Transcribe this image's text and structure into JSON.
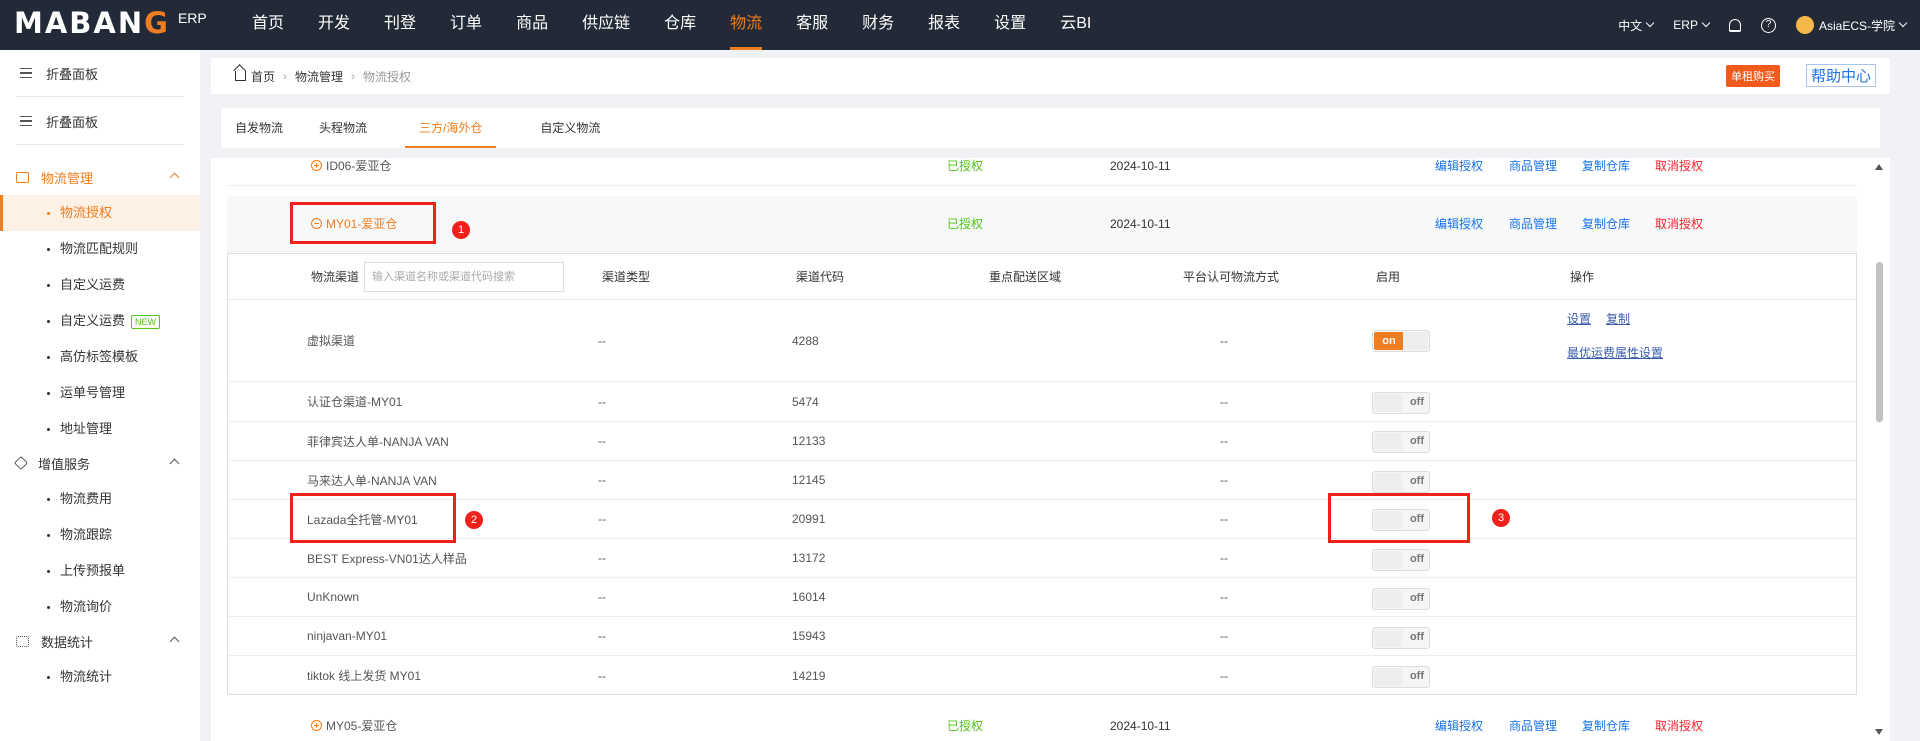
{
  "topbar": {
    "logo_main": "MABANG",
    "logo_erp": "ERP",
    "nav": [
      "首页",
      "开发",
      "刊登",
      "订单",
      "商品",
      "供应链",
      "仓库",
      "物流",
      "客服",
      "财务",
      "报表",
      "设置",
      "云BI"
    ],
    "active_nav": "物流",
    "lang": "中文",
    "erp": "ERP",
    "user": "AsiaECS-学院"
  },
  "sidebar": {
    "collapse1": "折叠面板",
    "collapse2": "折叠面板",
    "groups": [
      {
        "label": "物流管理",
        "items": [
          "物流授权",
          "物流匹配规则",
          "自定义运费",
          "自定义运费",
          "高仿标签模板",
          "运单号管理",
          "地址管理"
        ]
      },
      {
        "label": "增值服务",
        "items": [
          "物流费用",
          "物流跟踪",
          "上传预报单",
          "物流询价"
        ]
      },
      {
        "label": "数据统计",
        "items": [
          "物流统计"
        ]
      }
    ],
    "new_badge": "NEW",
    "active_item": "物流授权"
  },
  "breadcrumb": {
    "home": "首页",
    "level1": "物流管理",
    "current": "物流授权"
  },
  "buttons": {
    "buy": "单租购买",
    "help": "帮助中心"
  },
  "tabs": [
    "自发物流",
    "头程物流",
    "三方/海外仓",
    "自定义物流"
  ],
  "active_tab": "三方/海外仓",
  "warehouses": [
    {
      "name": "ID06-爱亚仓",
      "status": "已授权",
      "date": "2024-10-11"
    },
    {
      "name": "MY01-爱亚仓",
      "status": "已授权",
      "date": "2024-10-11"
    },
    {
      "name": "MY05-爱亚仓",
      "status": "已授权",
      "date": "2024-10-11"
    }
  ],
  "actions": {
    "edit": "编辑授权",
    "goods": "商品管理",
    "copy": "复制仓库",
    "cancel": "取消授权"
  },
  "subtable": {
    "headers": {
      "channel": "物流渠道",
      "type": "渠道类型",
      "code": "渠道代码",
      "region": "重点配送区域",
      "platform": "平台认可物流方式",
      "enable": "启用",
      "ops": "操作"
    },
    "search_placeholder": "输入渠道名称或渠道代码搜索",
    "rows": [
      {
        "name": "虚拟渠道",
        "type": "--",
        "code": "4288",
        "platform": "--",
        "enabled": "on"
      },
      {
        "name": "认证仓渠道-MY01",
        "type": "--",
        "code": "5474",
        "platform": "--",
        "enabled": "off"
      },
      {
        "name": "菲律宾达人单-NANJA VAN",
        "type": "--",
        "code": "12133",
        "platform": "--",
        "enabled": "off"
      },
      {
        "name": "马来达人单-NANJA VAN",
        "type": "--",
        "code": "12145",
        "platform": "--",
        "enabled": "off"
      },
      {
        "name": "Lazada全托管-MY01",
        "type": "--",
        "code": "20991",
        "platform": "--",
        "enabled": "off"
      },
      {
        "name": "BEST Express-VN01达人样品",
        "type": "--",
        "code": "13172",
        "platform": "--",
        "enabled": "off"
      },
      {
        "name": "UnKnown",
        "type": "--",
        "code": "16014",
        "platform": "--",
        "enabled": "off"
      },
      {
        "name": "ninjavan-MY01",
        "type": "--",
        "code": "15943",
        "platform": "--",
        "enabled": "off"
      },
      {
        "name": "tiktok 线上发货 MY01",
        "type": "--",
        "code": "14219",
        "platform": "--",
        "enabled": "off"
      }
    ],
    "op_set": "设置",
    "op_copy": "复制",
    "op_best": "最优运费属性设置"
  },
  "annotations": [
    "1",
    "2",
    "3"
  ]
}
